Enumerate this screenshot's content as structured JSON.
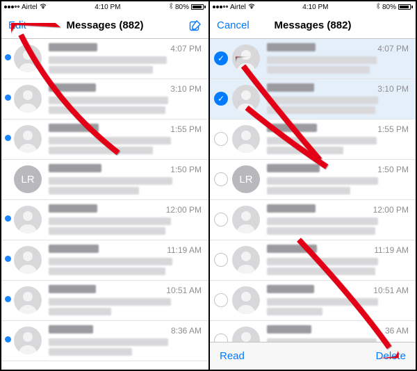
{
  "statusbar": {
    "carrier": "Airtel",
    "time": "4:10 PM",
    "battery": "80%"
  },
  "left": {
    "nav": {
      "left": "Edit",
      "title": "Messages (882)"
    },
    "rows": [
      {
        "time": "4:07 PM",
        "unread": true,
        "avatar": "person",
        "titleW": 70,
        "p1": 170,
        "p2": 150
      },
      {
        "time": "3:10 PM",
        "unread": true,
        "avatar": "person",
        "titleW": 68,
        "p1": 172,
        "p2": 168
      },
      {
        "time": "1:55 PM",
        "unread": true,
        "avatar": "person",
        "titleW": 72,
        "p1": 176,
        "p2": 150
      },
      {
        "time": "1:50 PM",
        "unread": false,
        "avatar": "LR",
        "titleW": 76,
        "p1": 178,
        "p2": 130
      },
      {
        "time": "12:00 PM",
        "unread": true,
        "avatar": "person",
        "titleW": 70,
        "p1": 176,
        "p2": 168
      },
      {
        "time": "11:19 AM",
        "unread": true,
        "avatar": "person",
        "titleW": 72,
        "p1": 178,
        "p2": 168
      },
      {
        "time": "10:51 AM",
        "unread": true,
        "avatar": "person",
        "titleW": 68,
        "p1": 176,
        "p2": 90
      },
      {
        "time": "8:36 AM",
        "unread": true,
        "avatar": "person",
        "titleW": 64,
        "p1": 172,
        "p2": 120
      }
    ]
  },
  "right": {
    "nav": {
      "left": "Cancel",
      "title": "Messages (882)"
    },
    "toolbar": {
      "read": "Read",
      "del": "Delete"
    },
    "rows": [
      {
        "time": "4:07 PM",
        "checked": true,
        "avatar": "person",
        "titleW": 70,
        "p1": 158,
        "p2": 148
      },
      {
        "time": "3:10 PM",
        "checked": true,
        "avatar": "person",
        "titleW": 68,
        "p1": 160,
        "p2": 156
      },
      {
        "time": "1:55 PM",
        "checked": false,
        "avatar": "person",
        "titleW": 72,
        "p1": 158,
        "p2": 110
      },
      {
        "time": "1:50 PM",
        "checked": false,
        "avatar": "LR",
        "titleW": 76,
        "p1": 160,
        "p2": 120
      },
      {
        "time": "12:00 PM",
        "checked": false,
        "avatar": "person",
        "titleW": 70,
        "p1": 160,
        "p2": 156
      },
      {
        "time": "11:19 AM",
        "checked": false,
        "avatar": "person",
        "titleW": 72,
        "p1": 160,
        "p2": 156
      },
      {
        "time": "10:51 AM",
        "checked": false,
        "avatar": "person",
        "titleW": 68,
        "p1": 160,
        "p2": 80
      },
      {
        "time": "36 AM",
        "checked": false,
        "avatar": "person",
        "titleW": 64,
        "p1": 158,
        "p2": 110
      }
    ]
  }
}
